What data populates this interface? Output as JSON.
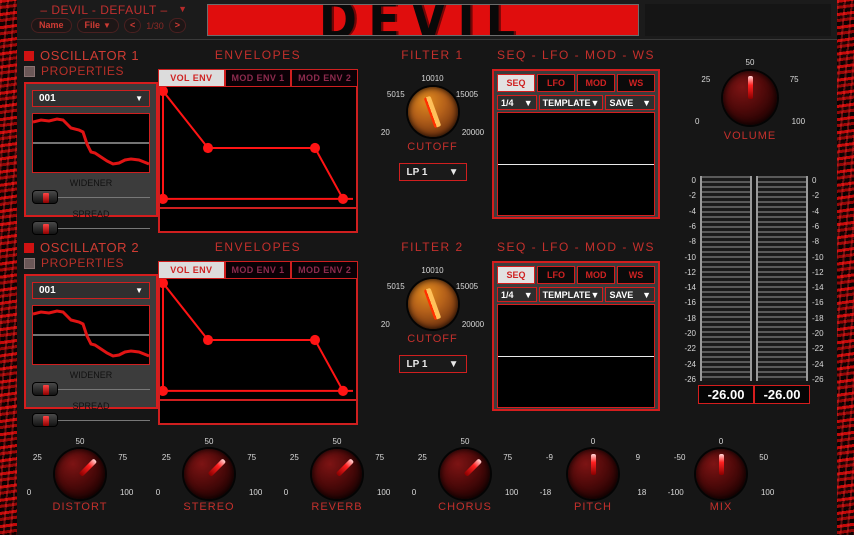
{
  "header": {
    "preset_title": "– DEVIL - DEFAULT –",
    "caret": "▼",
    "name_button": "Name",
    "file_button": "File",
    "file_caret": "▼",
    "prev_button": "<",
    "next_button": ">",
    "page_indicator": "1/30",
    "logo": "DEVIL"
  },
  "oscillators": [
    {
      "title": "OSCILLATOR 1",
      "properties_label": "PROPERTIES",
      "preset": "001",
      "caret": "▼",
      "widener_label": "WIDENER",
      "spread_label": "SPREAD"
    },
    {
      "title": "OSCILLATOR 2",
      "properties_label": "PROPERTIES",
      "preset": "001",
      "caret": "▼",
      "widener_label": "WIDENER",
      "spread_label": "SPREAD"
    }
  ],
  "envelopes": [
    {
      "title": "ENVELOPES",
      "tabs": [
        {
          "label": "VOL ENV",
          "active": true
        },
        {
          "label": "MOD ENV 1",
          "active": false
        },
        {
          "label": "MOD ENV 2",
          "active": false
        }
      ]
    },
    {
      "title": "ENVELOPES",
      "tabs": [
        {
          "label": "VOL ENV",
          "active": true
        },
        {
          "label": "MOD ENV 1",
          "active": false
        },
        {
          "label": "MOD ENV 2",
          "active": false
        }
      ]
    }
  ],
  "filters": [
    {
      "title": "FILTER 1",
      "knob_label": "CUTOFF",
      "ticks": {
        "min": "20",
        "low": "5015",
        "top": "10010",
        "high": "15005",
        "max": "20000"
      },
      "type_value": "LP 1",
      "type_caret": "▼"
    },
    {
      "title": "FILTER 2",
      "knob_label": "CUTOFF",
      "ticks": {
        "min": "20",
        "low": "5015",
        "top": "10010",
        "high": "15005",
        "max": "20000"
      },
      "type_value": "LP 1",
      "type_caret": "▼"
    }
  ],
  "seq_sections": [
    {
      "title": "SEQ - LFO - MOD - WS",
      "tabs": [
        {
          "label": "SEQ",
          "active": true
        },
        {
          "label": "LFO",
          "active": false
        },
        {
          "label": "MOD",
          "active": false
        },
        {
          "label": "WS",
          "active": false
        }
      ],
      "rate": "1/4",
      "rate_caret": "▼",
      "template_label": "TEMPLATE",
      "template_caret": "▼",
      "save_label": "SAVE",
      "save_caret": "▼"
    },
    {
      "title": "SEQ - LFO - MOD - WS",
      "tabs": [
        {
          "label": "SEQ",
          "active": true
        },
        {
          "label": "LFO",
          "active": false
        },
        {
          "label": "MOD",
          "active": false
        },
        {
          "label": "WS",
          "active": false
        }
      ],
      "rate": "1/4",
      "rate_caret": "▼",
      "template_label": "TEMPLATE",
      "template_caret": "▼",
      "save_label": "SAVE",
      "save_caret": "▼"
    }
  ],
  "volume": {
    "label": "VOLUME",
    "ticks": {
      "min": "0",
      "low": "25",
      "top": "50",
      "high": "75",
      "max": "100"
    },
    "value": 50
  },
  "meters": {
    "scale": [
      "0",
      "-2",
      "-4",
      "-6",
      "-8",
      "-10",
      "-12",
      "-14",
      "-16",
      "-18",
      "-20",
      "-22",
      "-24",
      "-26"
    ],
    "left_value": "-26.00",
    "right_value": "-26.00"
  },
  "bottom_knobs": [
    {
      "name": "DISTORT",
      "ticks": {
        "min": "0",
        "low": "25",
        "top": "50",
        "high": "75",
        "max": "100"
      },
      "angle": 45
    },
    {
      "name": "STEREO",
      "ticks": {
        "min": "0",
        "low": "25",
        "top": "50",
        "high": "75",
        "max": "100"
      },
      "angle": 45
    },
    {
      "name": "REVERB",
      "ticks": {
        "min": "0",
        "low": "25",
        "top": "50",
        "high": "75",
        "max": "100"
      },
      "angle": 45
    },
    {
      "name": "CHORUS",
      "ticks": {
        "min": "0",
        "low": "25",
        "top": "50",
        "high": "75",
        "max": "100"
      },
      "angle": 45
    },
    {
      "name": "PITCH",
      "ticks": {
        "min": "-18",
        "low": "-9",
        "top": "0",
        "high": "9",
        "max": "18"
      },
      "angle": 0
    },
    {
      "name": "MIX",
      "ticks": {
        "min": "-100",
        "low": "-50",
        "top": "0",
        "high": "50",
        "max": "100"
      },
      "angle": 0
    }
  ],
  "colors": {
    "accent_red": "#cf1f1f",
    "text_red": "#c4302c",
    "amber": "#d98220",
    "panel_bg": "#161616"
  }
}
